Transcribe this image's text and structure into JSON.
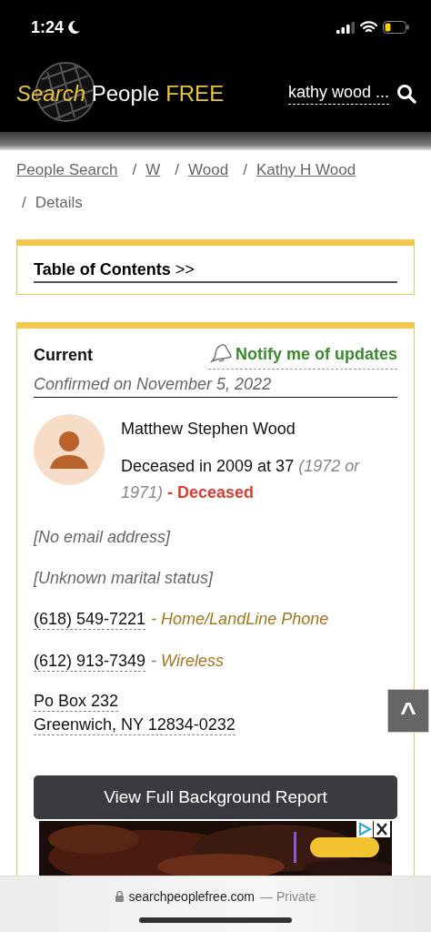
{
  "status_bar": {
    "time": "1:24"
  },
  "header": {
    "logo": [
      {
        "text": "Search",
        "kind": "accent-italic"
      },
      {
        "text": "People",
        "kind": "plain"
      },
      {
        "text": "FREE",
        "kind": "accent"
      }
    ],
    "search_value": "kathy wood ..."
  },
  "breadcrumbs": [
    {
      "label": "People Search",
      "link": true
    },
    {
      "separator": "/",
      "label": "W",
      "link": true
    },
    {
      "separator": "/",
      "label": "Wood",
      "link": true
    },
    {
      "separator": "/",
      "label": "Kathy H Wood",
      "link": true
    },
    {
      "separator": "/",
      "label": "Details",
      "link": false
    }
  ],
  "toc": {
    "label": "Table of Contents",
    "arrow": ">>"
  },
  "record": {
    "section": "Current",
    "notify": "Notify me of updates",
    "confirmed": "Confirmed on November 5, 2022",
    "name": "Matthew Stephen Wood",
    "death": "Deceased in 2009 at 37",
    "years": "(1972 or 1971)",
    "status": "- Deceased",
    "email": "[No email address]",
    "marital": "[Unknown marital status]",
    "phones": [
      {
        "number": "(618) 549-7221",
        "type": "- Home/LandLine Phone"
      },
      {
        "number": "(612) 913-7349",
        "type": "- Wireless"
      }
    ],
    "address": [
      "Po Box 232",
      "Greenwich, NY 12834-0232"
    ],
    "report_button": "View Full Background Report"
  },
  "scroll_top": "^",
  "browser": {
    "domain": "searchpeoplefree.com",
    "mode": "— Private"
  }
}
